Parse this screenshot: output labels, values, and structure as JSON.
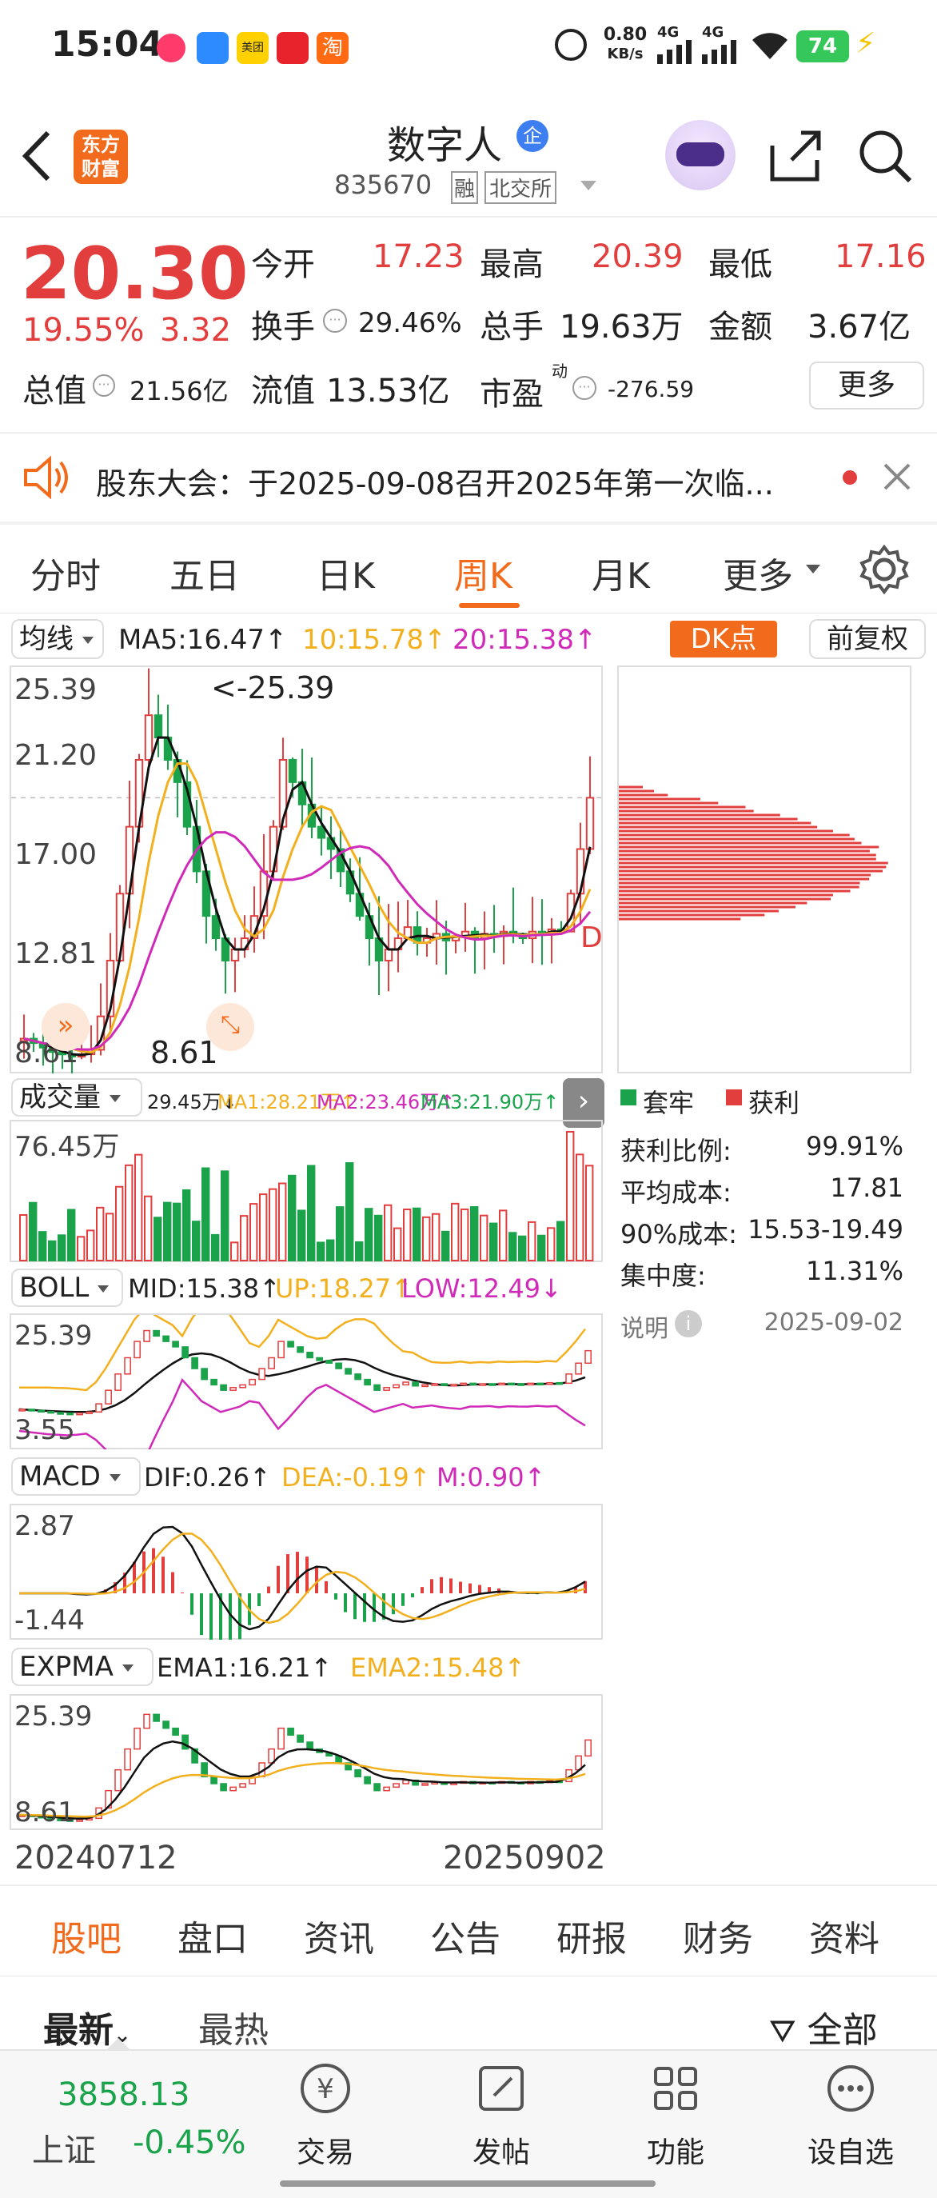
{
  "status_bar": {
    "time": "15:04",
    "net_speed": "0.80",
    "net_unit": "KB/s",
    "sig1": "4G",
    "sig2": "4G",
    "battery": "74",
    "app_badges": [
      "美团",
      "淘"
    ]
  },
  "header": {
    "logo": "东方财富",
    "name": "数字人",
    "code": "835670",
    "tag1": "融",
    "tag2": "北交所"
  },
  "quote": {
    "price": "20.30",
    "change_pct": "19.55%",
    "change_amt": "3.32",
    "open_label": "今开",
    "open": "17.23",
    "high_label": "最高",
    "high": "20.39",
    "low_label": "最低",
    "low": "17.16",
    "turnover_label": "换手",
    "turnover": "29.46%",
    "volume_label": "总手",
    "volume": "19.63万",
    "amount_label": "金额",
    "amount": "3.67亿",
    "mktcap_label": "总值",
    "mktcap": "21.56亿",
    "float_label": "流值",
    "float": "13.53亿",
    "pe_label": "市盈",
    "pe_sup": "动",
    "pe": "-276.59",
    "more": "更多"
  },
  "notice": {
    "text": "股东大会：于2025-09-08召开2025年第一次临..."
  },
  "chart_tabs": [
    "分时",
    "五日",
    "日K",
    "周K",
    "月K",
    "更多"
  ],
  "active_tab": "周K",
  "ma_bar": {
    "selector": "均线",
    "ma5": "MA5:16.47↑",
    "ma10": "10:15.78↑",
    "ma20": "20:15.38↑",
    "dk": "DK点",
    "adjust": "前复权"
  },
  "kline": {
    "y_labels": [
      "25.39",
      "21.20",
      "17.00",
      "12.81",
      "8.61"
    ],
    "high_note": "<-25.39",
    "low_note": "8.61",
    "signal_D": "D"
  },
  "volume_bar": {
    "selector": "成交量",
    "vol": "29.45万↓",
    "ma1": "MA1:28.21万↑",
    "ma2": "MA2:23.46万↑",
    "ma3": "MA3:21.90万↑",
    "y_label": "76.45万"
  },
  "boll_bar": {
    "selector": "BOLL",
    "mid": "MID:15.38↑",
    "up": "UP:18.27↑",
    "low": "LOW:12.49↓",
    "y_top": "25.39",
    "y_bottom": "3.55"
  },
  "macd_bar": {
    "selector": "MACD",
    "dif": "DIF:0.26↑",
    "dea": "DEA:-0.19↑",
    "m": "M:0.90↑",
    "y_top": "2.87",
    "y_bottom": "-1.44"
  },
  "expma_bar": {
    "selector": "EXPMA",
    "ema1": "EMA1:16.21↑",
    "ema2": "EMA2:15.48↑",
    "y_top": "25.39",
    "y_bottom": "8.61"
  },
  "date_axis": {
    "start": "20240712",
    "end": "20250902"
  },
  "chip": {
    "legend_trapped": "套牢",
    "legend_profit": "获利",
    "rows": [
      {
        "label": "获利比例:",
        "value": "99.91%"
      },
      {
        "label": "平均成本:",
        "value": "17.81"
      },
      {
        "label": "90%成本:",
        "value": "15.53-19.49"
      },
      {
        "label": "集中度:",
        "value": "11.31%"
      }
    ],
    "note_label": "说明",
    "note_date": "2025-09-02"
  },
  "bottom_tabs": [
    "股吧",
    "盘口",
    "资讯",
    "公告",
    "研报",
    "财务",
    "资料"
  ],
  "active_bottom_tab": "股吧",
  "sort_tabs": {
    "latest": "最新",
    "hot": "最热",
    "filter": "全部"
  },
  "nav": {
    "index_value": "3858.13",
    "index_name": "上证",
    "index_change": "-0.45%",
    "items": [
      "交易",
      "发帖",
      "功能",
      "设自选"
    ],
    "trade_symbol": "¥"
  },
  "colors": {
    "up": "#e33e3e",
    "down": "#1aa34a",
    "accent": "#f26b1d",
    "ma10": "#f2b01e",
    "ma20": "#d02ab8"
  }
}
